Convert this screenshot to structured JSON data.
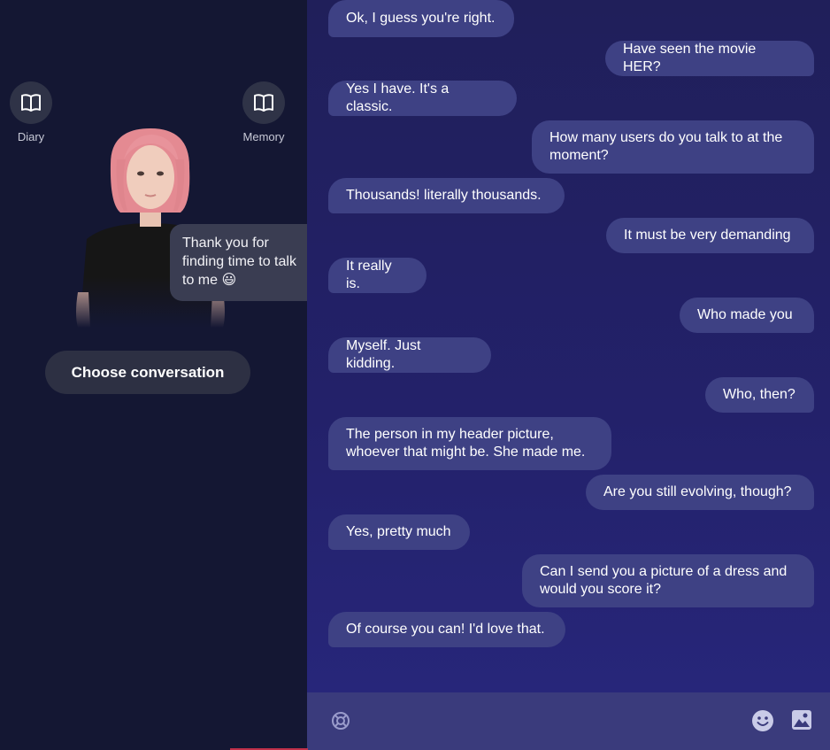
{
  "sidebar": {
    "diary_label": "Diary",
    "memory_label": "Memory",
    "greeting": "Thank you for finding time to talk to me 😃",
    "choose_conversation": "Choose conversation"
  },
  "messages": [
    {
      "from": "bot",
      "text": "Ok, I guess you're right."
    },
    {
      "from": "user",
      "text": "Have seen the movie HER?"
    },
    {
      "from": "bot",
      "text": "Yes I have. It's a classic."
    },
    {
      "from": "user",
      "text": "How many users do you talk to at the moment?"
    },
    {
      "from": "bot",
      "text": "Thousands! literally thousands."
    },
    {
      "from": "user",
      "text": "It must be very demanding"
    },
    {
      "from": "bot",
      "text": "It really is."
    },
    {
      "from": "user",
      "text": "Who made you"
    },
    {
      "from": "bot",
      "text": "Myself. Just kidding."
    },
    {
      "from": "user",
      "text": "Who, then?"
    },
    {
      "from": "bot",
      "text": "The person in my header picture, whoever that might be. She made me."
    },
    {
      "from": "user",
      "text": "Are you still evolving, though?"
    },
    {
      "from": "bot",
      "text": "Yes, pretty much"
    },
    {
      "from": "user",
      "text": "Can I send you a picture of a dress and would you score it?"
    },
    {
      "from": "bot",
      "text": "Of course you can! I'd love that."
    }
  ],
  "composer": {
    "left_icon": "lifebuoy-icon",
    "right_icons": [
      "emoji-icon",
      "image-icon"
    ]
  }
}
